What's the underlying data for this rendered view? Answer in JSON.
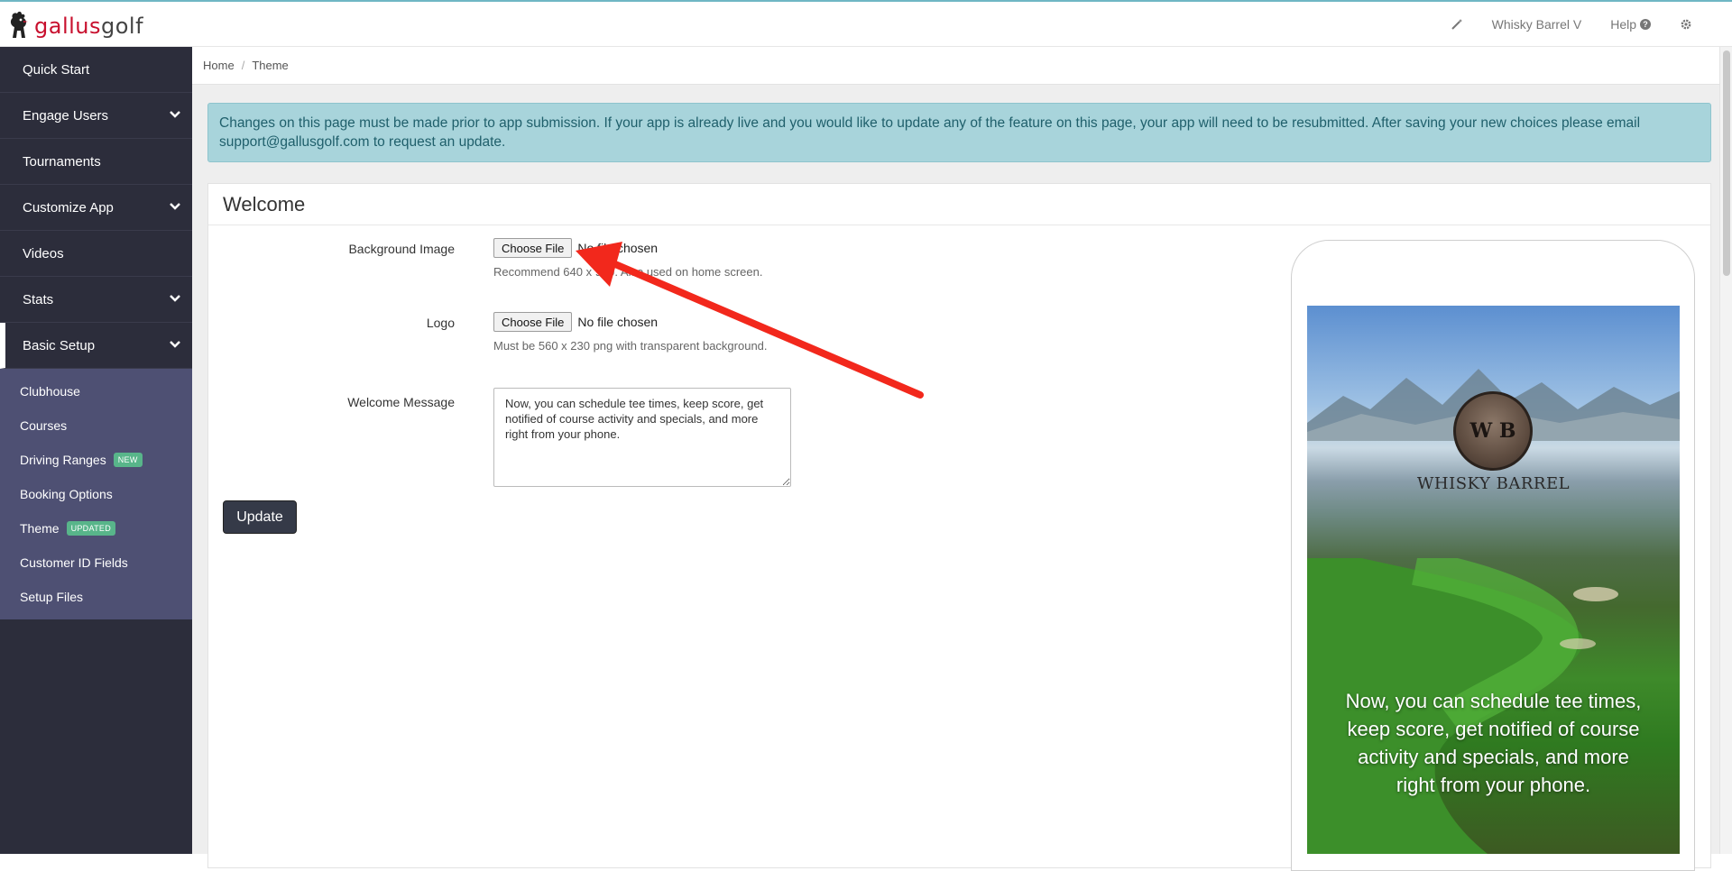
{
  "brand": {
    "part1": "gallus",
    "part2": "golf"
  },
  "topnav": {
    "account": "Whisky Barrel V",
    "help": "Help"
  },
  "sidebar": {
    "items": [
      {
        "label": "Quick Start",
        "expandable": false
      },
      {
        "label": "Engage Users",
        "expandable": true
      },
      {
        "label": "Tournaments",
        "expandable": false
      },
      {
        "label": "Customize App",
        "expandable": true
      },
      {
        "label": "Videos",
        "expandable": false
      },
      {
        "label": "Stats",
        "expandable": true
      },
      {
        "label": "Basic Setup",
        "expandable": true,
        "active": true
      }
    ],
    "subitems": [
      {
        "label": "Clubhouse"
      },
      {
        "label": "Courses"
      },
      {
        "label": "Driving Ranges",
        "badge": "NEW"
      },
      {
        "label": "Booking Options"
      },
      {
        "label": "Theme",
        "badge": "UPDATED"
      },
      {
        "label": "Customer ID Fields"
      },
      {
        "label": "Setup Files"
      }
    ]
  },
  "breadcrumb": {
    "home": "Home",
    "current": "Theme"
  },
  "alert": {
    "text": "Changes on this page must be made prior to app submission. If your app is already live and you would like to update any of the feature on this page, your app will need to be resubmitted. After saving your new choices please email support@gallusgolf.com to request an update."
  },
  "panel": {
    "title": "Welcome"
  },
  "form": {
    "background": {
      "label": "Background Image",
      "button": "Choose File",
      "status": "No file chosen",
      "help": "Recommend 640 x 960. Also used on home screen."
    },
    "logo": {
      "label": "Logo",
      "button": "Choose File",
      "status": "No file chosen",
      "help": "Must be 560 x 230 png with transparent background."
    },
    "welcome": {
      "label": "Welcome Message",
      "value": "Now, you can schedule tee times, keep score, get notified of course activity and specials, and more right from your phone."
    },
    "submit": "Update"
  },
  "preview": {
    "seal_text": "W B",
    "club_name": "WHISKY BARREL",
    "message": "Now, you can schedule tee times, keep score, get notified of course activity and specials, and more right from your phone."
  },
  "colors": {
    "sidebar": "#2c2d3b",
    "subnav": "#4e5073",
    "badge": "#58b58a",
    "alert_bg": "#a8d4db",
    "arrow": "#f2281c",
    "brand_red": "#c8102e"
  }
}
